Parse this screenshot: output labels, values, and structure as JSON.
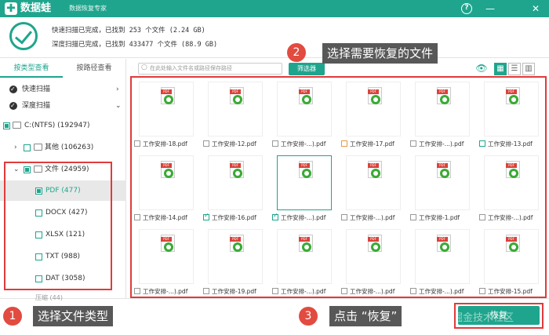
{
  "app": {
    "name": "数据蛙",
    "subtitle": "数据恢复专家",
    "logo": "✚",
    "help": "?",
    "min": "—",
    "close": "✕"
  },
  "scan": {
    "quick": "快速扫描已完成，已找到 253 个文件 (2.24 GB)",
    "deep": "深度扫描已完成，已找到 433477 个文件 (88.9 GB)"
  },
  "tabs": {
    "by_type": "按类型查看",
    "by_path": "按路径查看"
  },
  "tree": {
    "quick_scan": "快速扫描",
    "deep_scan": "深度扫描",
    "drive": "C:(NTFS) (192947)",
    "other": "其他 (106263)",
    "documents": "文件 (24959)",
    "pdf": "PDF (477)",
    "docx": "DOCX (427)",
    "xlsx": "XLSX (121)",
    "txt": "TXT (988)",
    "dat": "DAT (3058)",
    "partial_next": "压缩 (44)"
  },
  "toolbar": {
    "search_placeholder": "在此处输入文件名或路径保存路径",
    "filter": "筛选器",
    "eye": "👁",
    "view_grid": "▦",
    "view_list": "☰",
    "view_detail": "▥"
  },
  "files": [
    [
      "工作安排-18.pdf",
      "工作安排-12.pdf",
      "工作安排-...).pdf",
      "工作安排-17.pdf",
      "工作安排-...).pdf",
      "工作安排-13.pdf"
    ],
    [
      "工作安排-14.pdf",
      "工作安排-16.pdf",
      "工作安排-...).pdf",
      "工作安排-...).pdf",
      "工作安排-1.pdf",
      "工作安排-...).pdf"
    ],
    [
      "工作安排-...).pdf",
      "工作安排-19.pdf",
      "工作安排-...).pdf",
      "工作安排-...).pdf",
      "工作安排-...).pdf",
      "工作安排-15.pdf"
    ]
  ],
  "pdf_tag": "PDF",
  "recover_button": "恢复",
  "annotations": {
    "n1": "1",
    "t1": "选择文件类型",
    "n2": "2",
    "t2": "选择需要恢复的文件",
    "n3": "3",
    "t3": "点击 “恢复”"
  },
  "watermark": "@稀土掘金技术社区",
  "colors": {
    "accent": "#1fa58d",
    "annotation": "#e03b3b",
    "callout_bg": "#585858"
  }
}
